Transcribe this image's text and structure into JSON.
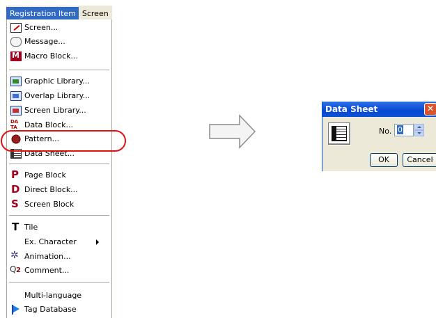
{
  "menubar": {
    "items": [
      {
        "label": "Registration Item"
      },
      {
        "label": "Screen"
      }
    ]
  },
  "menu": {
    "items": [
      {
        "label": "Screen...",
        "icon": "screen-icon"
      },
      {
        "label": "Message...",
        "icon": "message-icon"
      },
      {
        "label": "Macro Block...",
        "icon": "macro-icon"
      },
      {
        "label": "Graphic Library...",
        "icon": "graphic-library-icon"
      },
      {
        "label": "Overlap Library...",
        "icon": "overlap-library-icon"
      },
      {
        "label": "Screen Library...",
        "icon": "screen-library-icon"
      },
      {
        "label": "Data Block...",
        "icon": "data-block-icon"
      },
      {
        "label": "Pattern...",
        "icon": "pattern-icon"
      },
      {
        "label": "Data Sheet...",
        "icon": "data-sheet-icon"
      },
      {
        "label": "Page Block",
        "icon": "page-block-icon"
      },
      {
        "label": "Direct Block...",
        "icon": "direct-block-icon"
      },
      {
        "label": "Screen Block",
        "icon": "screen-block-icon"
      },
      {
        "label": "Tile",
        "icon": "tile-icon"
      },
      {
        "label": "Ex. Character",
        "icon": ""
      },
      {
        "label": "Animation...",
        "icon": "animation-icon"
      },
      {
        "label": "Comment...",
        "icon": "comment-icon"
      },
      {
        "label": "Multi-language",
        "icon": ""
      },
      {
        "label": "Tag Database",
        "icon": "tag-database-icon"
      }
    ]
  },
  "highlight": {
    "color": "#e01010"
  },
  "dialog": {
    "title": "Data Sheet",
    "no_label": "No.",
    "no_value": "0",
    "ok_label": "OK",
    "cancel_label": "Cancel"
  },
  "colors": {
    "menu_selected": "#316ac5",
    "titlebar": "#0a48d4",
    "close_button": "#d8542c"
  }
}
